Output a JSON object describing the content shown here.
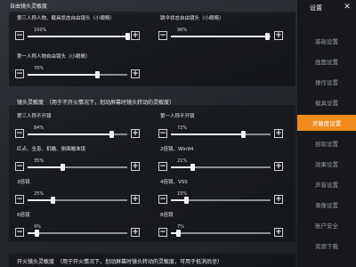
{
  "sidebar": {
    "title": "设置",
    "items": [
      {
        "label": "基础设置"
      },
      {
        "label": "画面设置"
      },
      {
        "label": "操作设置"
      },
      {
        "label": "载具设置"
      },
      {
        "label": "灵敏度设置"
      },
      {
        "label": "拾取设置"
      },
      {
        "label": "效果设置"
      },
      {
        "label": "声音设置"
      },
      {
        "label": "录像设置"
      },
      {
        "label": "账户安全"
      },
      {
        "label": "资源下载"
      }
    ],
    "active_index": 4,
    "accent": "#f08a1c"
  },
  "free_look": {
    "title": "自由镜头灵敏度",
    "sliders": [
      {
        "label": "第三人称人物、载具状态自由镜头（小眼睛）",
        "value_text": "100%",
        "value": 100
      },
      {
        "label": "跳伞状态自由镜头（小眼睛）",
        "value_text": "96%",
        "value": 96
      },
      {
        "label": "第一人称人物自由镜头（小眼睛）",
        "value_text": "70%",
        "value": 70
      }
    ]
  },
  "camera": {
    "title": "镜头灵敏度　（用于不开火情况下，划动屏幕时镜头转动的灵敏度）",
    "sliders": [
      {
        "label": "第三人称不开镜",
        "value_text": "84%",
        "value": 84
      },
      {
        "label": "第一人称不开镜",
        "value_text": "72%",
        "value": 72
      },
      {
        "label": "红点、全息、机瞄、侧面瞄准镜",
        "value_text": "35%",
        "value": 35
      },
      {
        "label": "2倍镜、Win94",
        "value_text": "21%",
        "value": 21
      },
      {
        "label": "3倍镜",
        "value_text": "25%",
        "value": 25
      },
      {
        "label": "4倍镜、VSS",
        "value_text": "15%",
        "value": 15
      },
      {
        "label": "6倍镜",
        "value_text": "9%",
        "value": 9
      },
      {
        "label": "8倍镜",
        "value_text": "7%",
        "value": 7
      }
    ]
  },
  "next_section": {
    "title": "开火镜头灵敏度　（用于开火情况下，划动屏幕时镜头转动的灵敏度，可用于抵消后坐）"
  },
  "controls": {
    "minus": "−",
    "plus": "+",
    "close": "✕"
  }
}
